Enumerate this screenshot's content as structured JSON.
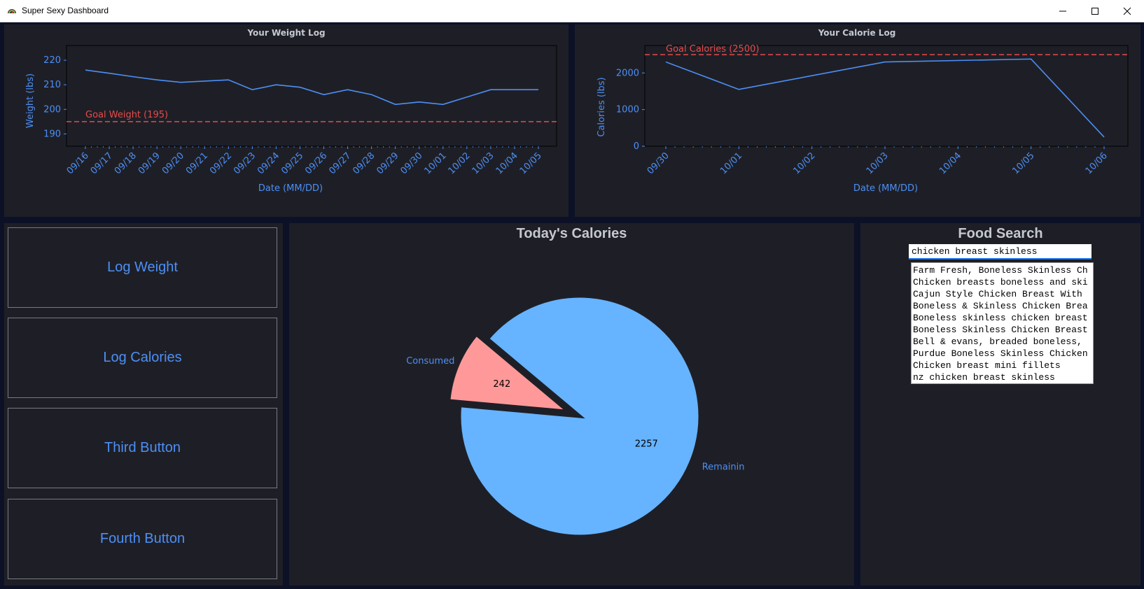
{
  "window": {
    "title": "Super Sexy Dashboard",
    "controls": [
      "minimize",
      "maximize",
      "close"
    ]
  },
  "colors": {
    "accent": "#4d8ff6",
    "goal_line": "#e84a4a",
    "panel_bg": "#1e1f26",
    "app_bg": "#0d1127",
    "pie_consumed": "#ff9999",
    "pie_remaining": "#66b3ff"
  },
  "charts": {
    "weight": {
      "title": "Your Weight Log",
      "xlabel": "Date (MM/DD)",
      "ylabel": "Weight (lbs)",
      "goal_label": "Goal Weight (195)"
    },
    "calories": {
      "title": "Your Calorie Log",
      "xlabel": "Date (MM/DD)",
      "ylabel": "Calories (lbs)",
      "goal_label": "Goal Calories (2500)"
    },
    "pie": {
      "title": "Today's Calories"
    }
  },
  "chart_data": [
    {
      "type": "line",
      "title": "Your Weight Log",
      "xlabel": "Date (MM/DD)",
      "ylabel": "Weight (lbs)",
      "x": [
        "09/16",
        "09/17",
        "09/18",
        "09/19",
        "09/20",
        "09/21",
        "09/22",
        "09/23",
        "09/24",
        "09/25",
        "09/26",
        "09/27",
        "09/28",
        "09/29",
        "09/30",
        "10/01",
        "10/02",
        "10/03",
        "10/04",
        "10/05"
      ],
      "values": [
        216,
        214.7,
        213.3,
        212,
        211,
        211.5,
        212,
        208,
        210,
        209,
        206,
        208,
        206,
        202,
        203,
        202,
        205,
        208,
        208,
        208
      ],
      "yticks": [
        190,
        200,
        210,
        220
      ],
      "ylim": [
        185,
        226
      ],
      "goal": 195,
      "goal_label": "Goal Weight (195)",
      "grid": false
    },
    {
      "type": "line",
      "title": "Your Calorie Log",
      "xlabel": "Date (MM/DD)",
      "ylabel": "Calories (lbs)",
      "x": [
        "09/30",
        "10/01",
        "10/03",
        "10/05",
        "10/06"
      ],
      "x_index": [
        0,
        1,
        3,
        5,
        6
      ],
      "xticks": [
        "09/30",
        "10/01",
        "10/02",
        "10/03",
        "10/04",
        "10/05",
        "10/06"
      ],
      "values": [
        2300,
        1550,
        2300,
        2380,
        250
      ],
      "yticks": [
        0,
        1000,
        2000
      ],
      "ylim": [
        0,
        2750
      ],
      "goal": 2500,
      "goal_label": "Goal Calories (2500)",
      "grid": false
    },
    {
      "type": "pie",
      "title": "Today's Calories",
      "labels": [
        "Consumed",
        "Remaining"
      ],
      "values": [
        242,
        2257
      ],
      "value_labels": [
        "242",
        "2257"
      ],
      "visible_labels": [
        "Consumed",
        "Remainin"
      ]
    }
  ],
  "buttons": [
    "Log Weight",
    "Log Calories",
    "Third Button",
    "Fourth Button"
  ],
  "food_search": {
    "title": "Food Search",
    "query": "chicken breast skinless",
    "results": [
      "Farm Fresh, Boneless Skinless Ch",
      "Chicken breasts boneless and ski",
      "Cajun Style Chicken Breast With",
      "Boneless & Skinless Chicken Brea",
      "Boneless skinless chicken breast",
      "Boneless Skinless Chicken Breast",
      "Bell & evans, breaded boneless,",
      "Purdue Boneless Skinless Chicken",
      "Chicken breast mini fillets",
      "nz chicken breast skinless"
    ]
  }
}
